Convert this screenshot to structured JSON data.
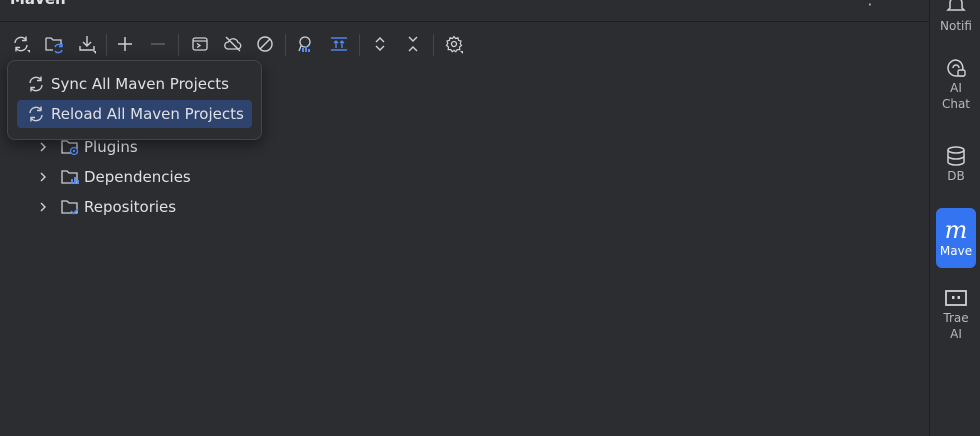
{
  "panel": {
    "title": "Maven",
    "more_glyph": "⋮"
  },
  "toolbar": {
    "buttons": [
      {
        "name": "sync-icon"
      },
      {
        "name": "reload-folder-icon"
      },
      {
        "name": "download-icon"
      },
      {
        "name": "add-icon"
      },
      {
        "name": "remove-icon"
      },
      {
        "name": "run-configuration-icon"
      },
      {
        "name": "offline-mode-icon"
      },
      {
        "name": "skip-tests-icon"
      },
      {
        "name": "show-dependencies-icon"
      },
      {
        "name": "collapse-up-icon"
      },
      {
        "name": "expand-all-icon"
      },
      {
        "name": "collapse-all-icon"
      },
      {
        "name": "settings-icon"
      }
    ]
  },
  "popup": {
    "items": [
      {
        "label": "Sync All Maven Projects",
        "selected": false
      },
      {
        "label": "Reload All Maven Projects",
        "selected": true
      }
    ]
  },
  "tree": {
    "items": [
      {
        "label": "Plugins",
        "icon": "plugins-folder-icon"
      },
      {
        "label": "Dependencies",
        "icon": "dependencies-folder-icon"
      },
      {
        "label": "Repositories",
        "icon": "repositories-folder-icon"
      }
    ]
  },
  "right_bar": {
    "items": [
      {
        "label": "Notifi",
        "icon": "notifications-icon"
      },
      {
        "label": "AI\nChat",
        "label_line1": "AI",
        "label_line2": "Chat",
        "icon": "ai-chat-icon"
      },
      {
        "label": "DB",
        "icon": "database-icon"
      },
      {
        "label": "Mave",
        "icon": "maven-icon",
        "glyph": "m",
        "active": true
      },
      {
        "label_line1": "Trae",
        "label_line2": "AI",
        "icon": "trae-ai-icon"
      }
    ]
  },
  "colors": {
    "background": "#2b2d30",
    "selection": "#2e436e",
    "accent": "#3574f0",
    "icon_blue": "#548af7",
    "text": "#dfe1e5"
  }
}
